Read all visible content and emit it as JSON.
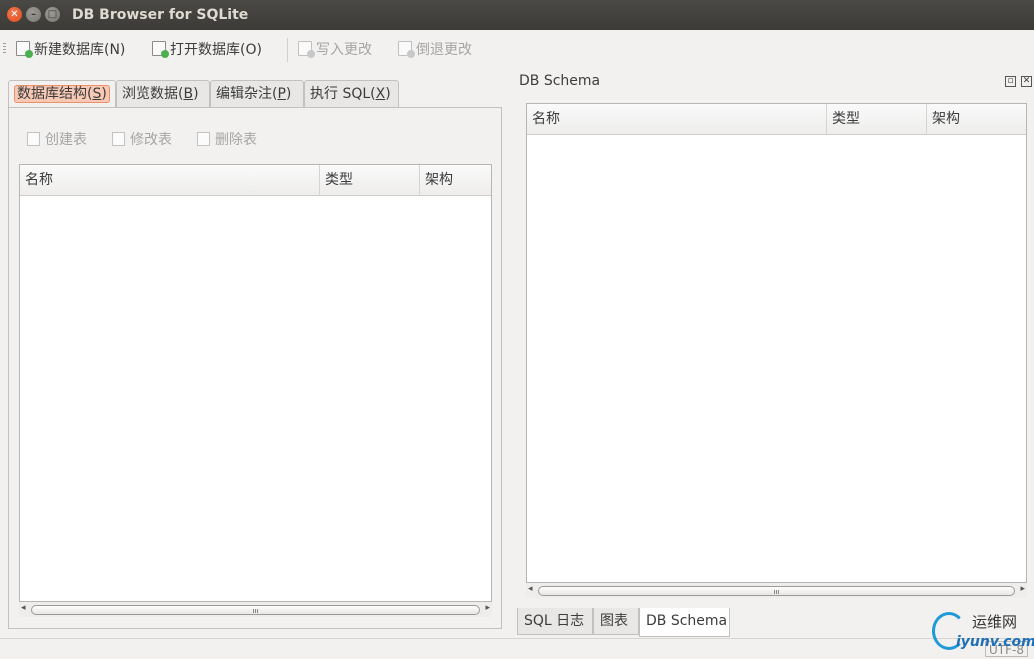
{
  "window": {
    "title": "DB Browser for SQLite"
  },
  "toolbar": {
    "new_db": "新建数据库(N)",
    "open_db": "打开数据库(O)",
    "write_changes": "写入更改",
    "revert_changes": "倒退更改"
  },
  "tabs": [
    {
      "pre": "数据库结构(",
      "key": "S",
      "post": ")"
    },
    {
      "pre": "浏览数据(",
      "key": "B",
      "post": ")"
    },
    {
      "pre": "编辑杂注(",
      "key": "P",
      "post": ")"
    },
    {
      "pre": "执行 SQL(",
      "key": "X",
      "post": ")"
    }
  ],
  "structure": {
    "create_table": "创建表",
    "modify_table": "修改表",
    "delete_table": "删除表",
    "columns": [
      "名称",
      "类型",
      "架构"
    ]
  },
  "dock": {
    "title": "DB Schema",
    "columns": [
      "名称",
      "类型",
      "架构"
    ],
    "tabs": [
      "SQL 日志",
      "图表",
      "DB Schema"
    ]
  },
  "status": {
    "encoding": "UTF-8"
  },
  "watermark": {
    "top": "运维网",
    "bottom": "iyunv.com"
  }
}
